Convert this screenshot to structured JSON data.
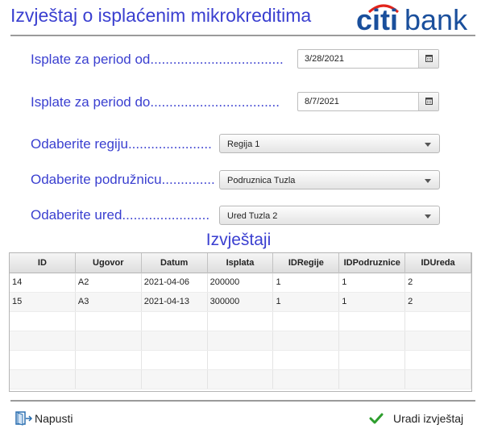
{
  "title": "Izvještaj o isplaćenim mikrokreditima",
  "logo_text": "citibank",
  "colors": {
    "accent": "#3a3fd0",
    "logo_blue": "#1a4f9c",
    "logo_red": "#e2231a",
    "check_green": "#2e9e2e"
  },
  "form": {
    "from_label": "Isplate za period od...................................",
    "from_value": "3/28/2021",
    "to_label": "Isplate za period do..................................",
    "to_value": "8/7/2021",
    "region_label": "Odaberite regiju......................",
    "region_value": "Regija 1",
    "branch_label": "Odaberite podružnicu..............",
    "branch_value": "Podruznica Tuzla",
    "office_label": "Odaberite ured.......................",
    "office_value": "Ured Tuzla 2",
    "calendar_icon": "calendar-icon",
    "dropdown_icon": "chevron-down-icon"
  },
  "report_heading": "Izvještaji",
  "table": {
    "columns": [
      "ID",
      "Ugovor",
      "Datum",
      "Isplata",
      "IDRegije",
      "IDPodruznice",
      "IDUreda"
    ],
    "rows": [
      [
        "14",
        "A2",
        "2021-04-06",
        "200000",
        "1",
        "1",
        "2"
      ],
      [
        "15",
        "A3",
        "2021-04-13",
        "300000",
        "1",
        "1",
        "2"
      ]
    ]
  },
  "footer": {
    "exit_label": "Napusti",
    "exit_icon": "exit-door-icon",
    "run_label": "Uradi izvještaj",
    "run_icon": "checkmark-icon"
  }
}
